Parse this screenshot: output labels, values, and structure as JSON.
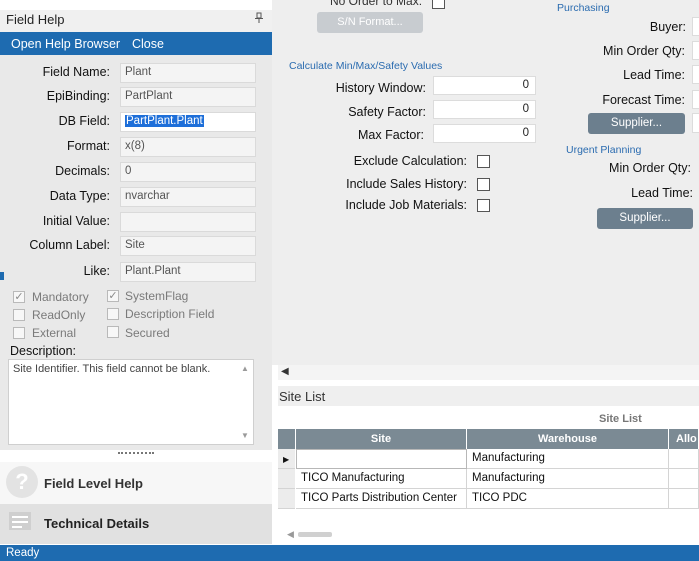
{
  "help_panel": {
    "title": "Field Help",
    "links": {
      "open_help_browser": "Open Help Browser",
      "close": "Close"
    },
    "fields": {
      "field_name": {
        "label": "Field Name:",
        "value": "Plant"
      },
      "epibinding": {
        "label": "EpiBinding:",
        "value": "PartPlant"
      },
      "db_field": {
        "label": "DB Field:",
        "value": "PartPlant.Plant"
      },
      "format": {
        "label": "Format:",
        "value": "x(8)"
      },
      "decimals": {
        "label": "Decimals:",
        "value": "0"
      },
      "data_type": {
        "label": "Data Type:",
        "value": "nvarchar"
      },
      "initial_value": {
        "label": "Initial Value:",
        "value": ""
      },
      "column_label": {
        "label": "Column Label:",
        "value": "Site"
      },
      "like": {
        "label": "Like:",
        "value": "Plant.Plant"
      }
    },
    "flags": {
      "mandatory": {
        "label": "Mandatory",
        "checked": true
      },
      "system_flag": {
        "label": "SystemFlag",
        "checked": true
      },
      "read_only": {
        "label": "ReadOnly",
        "checked": false
      },
      "description_field": {
        "label": "Description Field",
        "checked": false
      },
      "external": {
        "label": "External",
        "checked": false
      },
      "secured": {
        "label": "Secured",
        "checked": false
      }
    },
    "description_label": "Description:",
    "description_text": "Site Identifier. This field cannot be blank.",
    "sections": {
      "field_level_help": "Field Level Help",
      "technical_details": "Technical Details"
    }
  },
  "form": {
    "top_partial_label": "No Order to Max:",
    "sn_format_button": "S/N Format...",
    "calc_group": {
      "title": "Calculate Min/Max/Safety Values",
      "history_window": {
        "label": "History Window:",
        "value": "0"
      },
      "safety_factor": {
        "label": "Safety Factor:",
        "value": "0"
      },
      "max_factor": {
        "label": "Max Factor:",
        "value": "0"
      },
      "exclude_calculation": "Exclude Calculation:",
      "include_sales_history": "Include Sales History:",
      "include_job_materials": "Include Job Materials:"
    },
    "purchasing": {
      "title": "Purchasing",
      "buyer": "Buyer:",
      "min_order_qty": "Min Order Qty:",
      "lead_time": "Lead Time:",
      "forecast_time": "Forecast Time:",
      "supplier_button": "Supplier..."
    },
    "urgent_planning": {
      "title": "Urgent Planning",
      "min_order_qty": "Min Order Qty:",
      "lead_time": "Lead Time:",
      "supplier_button": "Supplier..."
    }
  },
  "site_list": {
    "panel_title": "Site List",
    "grid_caption": "Site List",
    "columns": [
      "Site",
      "Warehouse",
      "Allo"
    ],
    "rows": [
      {
        "site": "",
        "warehouse": "Manufacturing"
      },
      {
        "site": "TICO Manufacturing",
        "warehouse": "Manufacturing"
      },
      {
        "site": "TICO Parts Distribution Center",
        "warehouse": "TICO PDC"
      }
    ]
  },
  "status": {
    "text": "Ready"
  },
  "colors": {
    "accent": "#1e6bb0",
    "grid_header": "#7b8a94",
    "button": "#6c7f8e",
    "group_title": "#2b6cb0"
  }
}
